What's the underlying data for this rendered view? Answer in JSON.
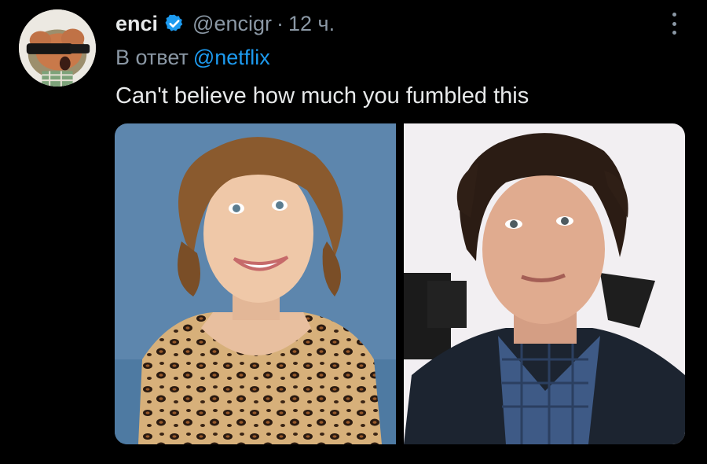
{
  "tweet": {
    "display_name": "enci",
    "handle": "@encigr",
    "separator": "·",
    "time": "12 ч.",
    "reply_prefix": "В ответ",
    "reply_mention": "@netflix",
    "text": "Can't believe how much you fumbled this"
  },
  "icons": {
    "verified": "verified-badge-icon",
    "more": "more-options-icon"
  },
  "media": {
    "photo_left": "photo of a woman with curly hair",
    "photo_right": "photo of a man with curly hair"
  },
  "colors": {
    "background": "#000000",
    "text": "#e7e9ea",
    "muted": "#8b98a5",
    "link": "#1d9bf0"
  }
}
